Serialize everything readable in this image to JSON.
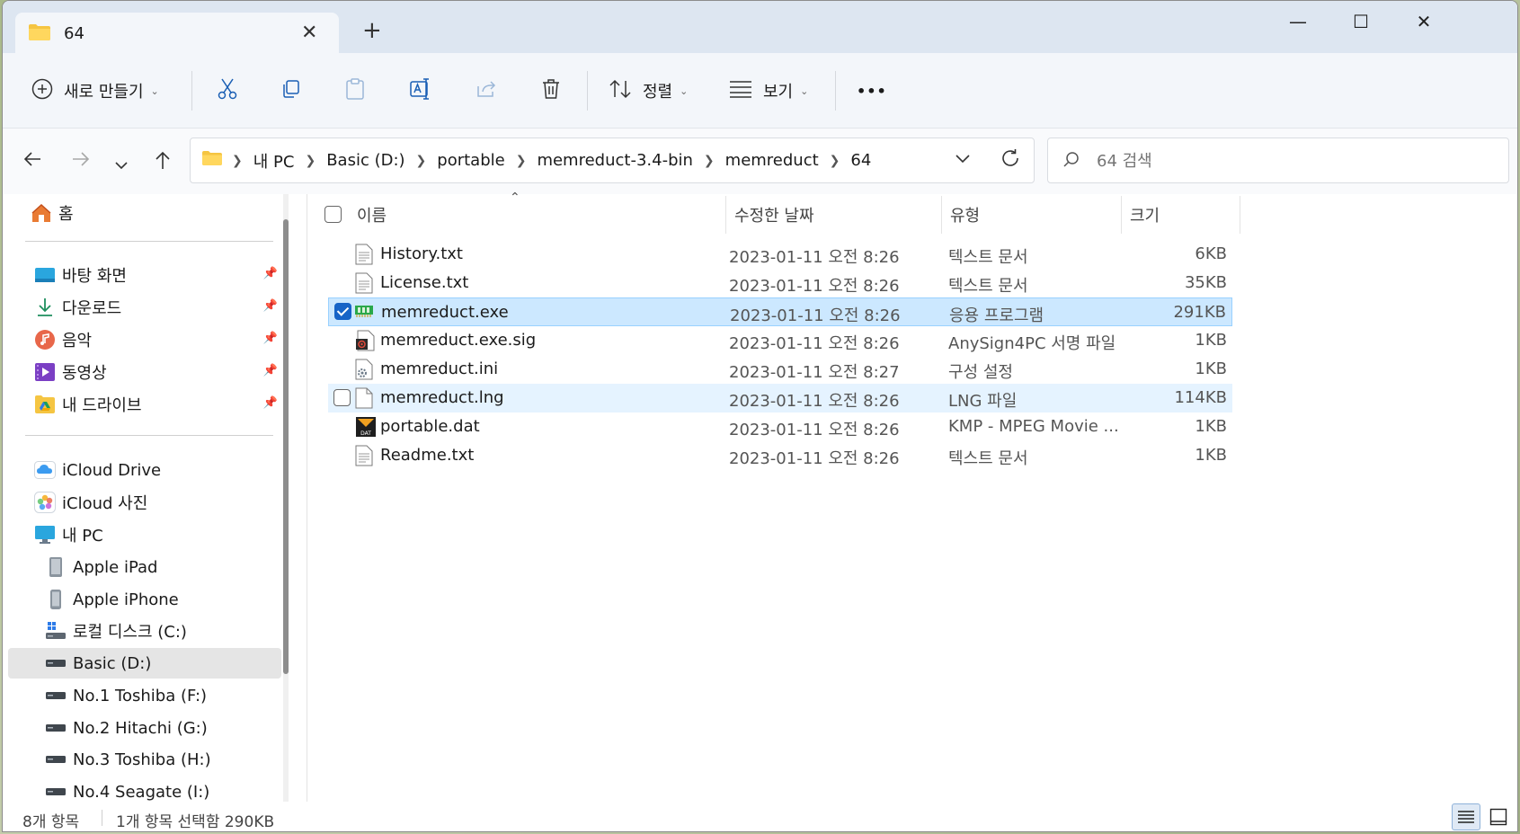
{
  "tab": {
    "title": "64",
    "close_glyph": "✕",
    "new_tab_glyph": "+"
  },
  "window_controls": {
    "minimize": "—",
    "maximize": "☐",
    "close": "✕"
  },
  "toolbar": {
    "new_label": "새로 만들기",
    "sort_label": "정렬",
    "view_label": "보기",
    "more_glyph": "•••"
  },
  "address": {
    "crumbs": [
      "내 PC",
      "Basic (D:)",
      "portable",
      "memreduct-3.4-bin",
      "memreduct",
      "64"
    ]
  },
  "search": {
    "placeholder": "64 검색"
  },
  "sidebar": {
    "home": "홈",
    "pinned": [
      "바탕 화면",
      "다운로드",
      "음악",
      "동영상",
      "내 드라이브"
    ],
    "icloud_drive": "iCloud Drive",
    "icloud_photos": "iCloud 사진",
    "this_pc": "내 PC",
    "devices": [
      "Apple iPad",
      "Apple iPhone",
      "로컬 디스크 (C:)",
      "Basic (D:)",
      "No.1 Toshiba (F:)",
      "No.2 Hitachi (G:)",
      "No.3 Toshiba (H:)",
      "No.4 Seagate (I:)"
    ]
  },
  "columns": {
    "name": "이름",
    "date": "수정한 날짜",
    "type": "유형",
    "size": "크기"
  },
  "files": [
    {
      "name": "History.txt",
      "date": "2023-01-11 오전 8:26",
      "type": "텍스트 문서",
      "size": "6KB",
      "icon": "text-file-icon"
    },
    {
      "name": "License.txt",
      "date": "2023-01-11 오전 8:26",
      "type": "텍스트 문서",
      "size": "35KB",
      "icon": "text-file-icon"
    },
    {
      "name": "memreduct.exe",
      "date": "2023-01-11 오전 8:26",
      "type": "응용 프로그램",
      "size": "291KB",
      "icon": "ram-app-icon"
    },
    {
      "name": "memreduct.exe.sig",
      "date": "2023-01-11 오전 8:26",
      "type": "AnySign4PC 서명 파일",
      "size": "1KB",
      "icon": "signature-file-icon"
    },
    {
      "name": "memreduct.ini",
      "date": "2023-01-11 오전 8:27",
      "type": "구성 설정",
      "size": "1KB",
      "icon": "settings-file-icon"
    },
    {
      "name": "memreduct.lng",
      "date": "2023-01-11 오전 8:26",
      "type": "LNG 파일",
      "size": "114KB",
      "icon": "blank-file-icon"
    },
    {
      "name": "portable.dat",
      "date": "2023-01-11 오전 8:26",
      "type": "KMP - MPEG Movie ...",
      "size": "1KB",
      "icon": "dat-file-icon"
    },
    {
      "name": "Readme.txt",
      "date": "2023-01-11 오전 8:26",
      "type": "텍스트 문서",
      "size": "1KB",
      "icon": "text-file-icon"
    }
  ],
  "status": {
    "count": "8개 항목",
    "selection": "1개 항목 선택함 290KB"
  },
  "colors": {
    "accent": "#1764c7",
    "selected_row": "#cce8ff",
    "hover_row": "#e5f3ff",
    "tabstrip": "#dde6f1"
  }
}
